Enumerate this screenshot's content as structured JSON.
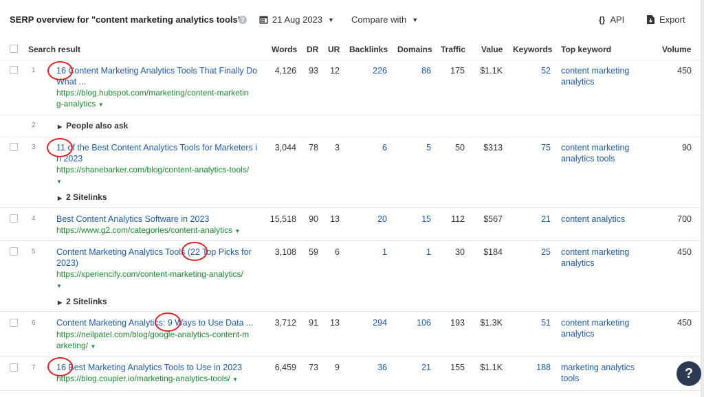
{
  "header": {
    "title": "SERP overview for \"content marketing analytics tools\"",
    "date": "21 Aug 2023",
    "compare_label": "Compare with",
    "api_label": "API",
    "export_label": "Export"
  },
  "columns": {
    "search_result": "Search result",
    "words": "Words",
    "dr": "DR",
    "ur": "UR",
    "backlinks": "Backlinks",
    "domains": "Domains",
    "traffic": "Traffic",
    "value": "Value",
    "keywords": "Keywords",
    "top_keyword": "Top keyword",
    "volume": "Volume"
  },
  "rows": [
    {
      "pos": "1",
      "title_line1": "16 Content Marketing Analytics Tools That Finally Do",
      "title_line2": "What ...",
      "url_line1": "https://blog.hubspot.com/marketing/content-marketin",
      "url_line2": "g-analytics",
      "words": "4,126",
      "dr": "93",
      "ur": "12",
      "backlinks": "226",
      "domains": "86",
      "traffic": "175",
      "value": "$1.1K",
      "keywords": "52",
      "top_kw_line1": "content marketing",
      "top_kw_line2": "analytics",
      "volume": "450"
    },
    {
      "pos": "2",
      "label": "People also ask"
    },
    {
      "pos": "3",
      "title_line1": "11 of the Best Content Analytics Tools for Marketers i",
      "title_line2": "n 2023",
      "url_line1": "https://shanebarker.com/blog/content-analytics-tools/",
      "words": "3,044",
      "dr": "78",
      "ur": "3",
      "backlinks": "6",
      "domains": "5",
      "traffic": "50",
      "value": "$313",
      "keywords": "75",
      "top_kw_line1": "content marketing",
      "top_kw_line2": "analytics tools",
      "volume": "90",
      "sitelinks": "2 Sitelinks"
    },
    {
      "pos": "4",
      "title_line1": "Best Content Analytics Software in 2023",
      "url_line1": "https://www.g2.com/categories/content-analytics",
      "words": "15,518",
      "dr": "90",
      "ur": "13",
      "backlinks": "20",
      "domains": "15",
      "traffic": "112",
      "value": "$567",
      "keywords": "21",
      "top_kw_line1": "content analytics",
      "volume": "700"
    },
    {
      "pos": "5",
      "title_line1": "Content Marketing Analytics Tools (22 Top Picks for",
      "title_line2": "2023)",
      "url_line1": "https://xperiencify.com/content-marketing-analytics/",
      "words": "3,108",
      "dr": "59",
      "ur": "6",
      "backlinks": "1",
      "domains": "1",
      "traffic": "30",
      "value": "$184",
      "keywords": "25",
      "top_kw_line1": "content marketing",
      "top_kw_line2": "analytics",
      "volume": "450",
      "sitelinks": "2 Sitelinks"
    },
    {
      "pos": "6",
      "title_line1": "Content Marketing Analytics: 9 Ways to Use Data ...",
      "url_line1": "https://neilpatel.com/blog/google-analytics-content-m",
      "url_line2": "arketing/",
      "words": "3,712",
      "dr": "91",
      "ur": "13",
      "backlinks": "294",
      "domains": "106",
      "traffic": "193",
      "value": "$1.3K",
      "keywords": "51",
      "top_kw_line1": "content marketing",
      "top_kw_line2": "analytics",
      "volume": "450"
    },
    {
      "pos": "7",
      "title_line1": "16 Best Marketing Analytics Tools to Use in 2023",
      "url_line1": "https://blog.coupler.io/marketing-analytics-tools/",
      "words": "6,459",
      "dr": "73",
      "ur": "9",
      "backlinks": "36",
      "domains": "21",
      "traffic": "155",
      "value": "$1.1K",
      "keywords": "188",
      "top_kw_line1": "marketing analytics",
      "top_kw_line2": "tools",
      "volume": ""
    }
  ],
  "help_fab": "?",
  "colors": {
    "link": "#1f5ba8",
    "url": "#1a8a2e",
    "annotation": "#e02020",
    "fab": "#2b3a52"
  }
}
